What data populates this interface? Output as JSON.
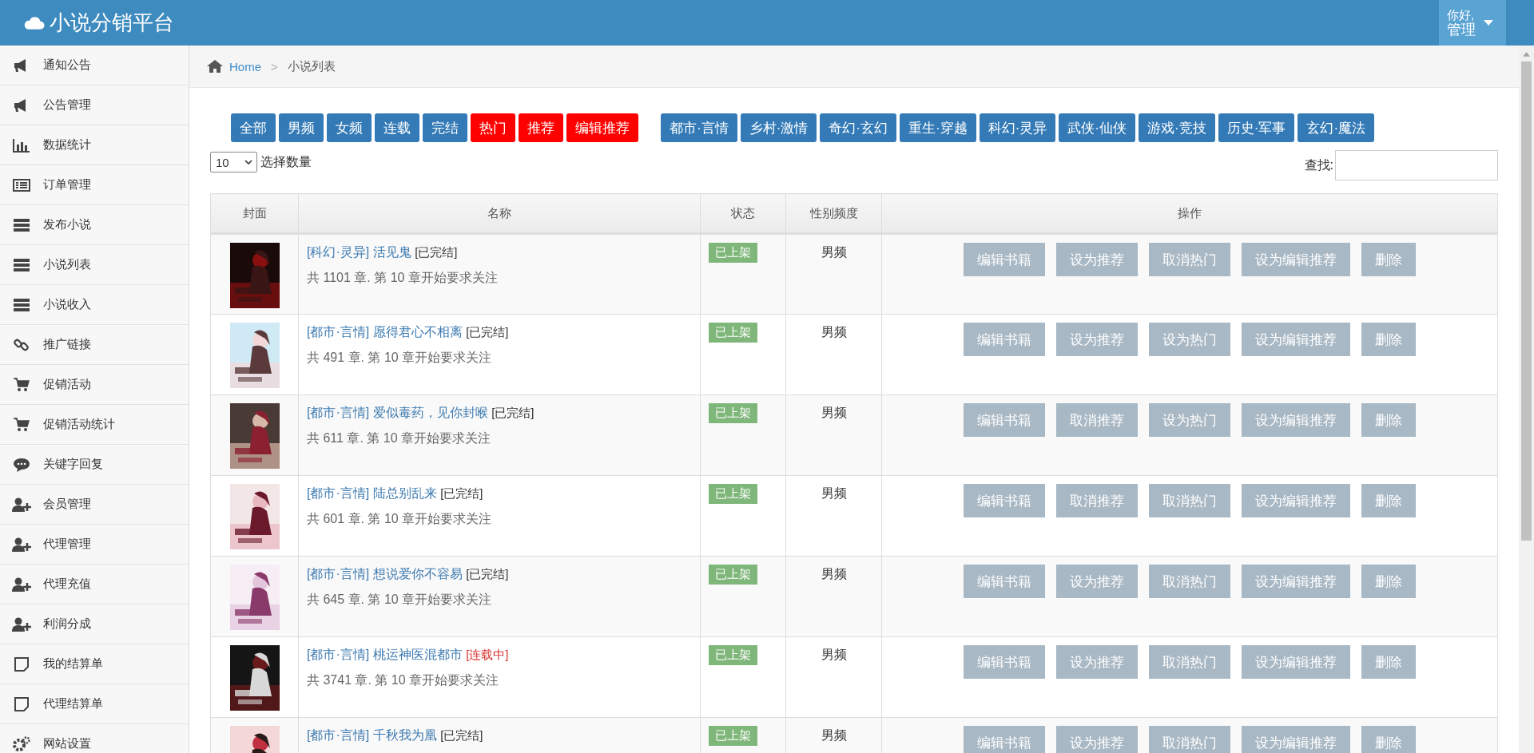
{
  "header": {
    "title": "小说分销平台",
    "user": {
      "greeting": "你好,",
      "name": "管理"
    }
  },
  "sidebar": {
    "items": [
      {
        "label": "通知公告"
      },
      {
        "label": "公告管理"
      },
      {
        "label": "数据统计"
      },
      {
        "label": "订单管理"
      },
      {
        "label": "发布小说"
      },
      {
        "label": "小说列表"
      },
      {
        "label": "小说收入"
      },
      {
        "label": "推广链接"
      },
      {
        "label": "促销活动"
      },
      {
        "label": "促销活动统计"
      },
      {
        "label": "关键字回复"
      },
      {
        "label": "会员管理"
      },
      {
        "label": "代理管理"
      },
      {
        "label": "代理充值"
      },
      {
        "label": "利润分成"
      },
      {
        "label": "我的结算单"
      },
      {
        "label": "代理结算单"
      },
      {
        "label": "网站设置"
      }
    ]
  },
  "breadcrumb": {
    "home": "Home",
    "separator": ">",
    "current": "小说列表"
  },
  "filters": {
    "groups": [
      [
        {
          "label": "全部",
          "kind": "plain"
        },
        {
          "label": "男频",
          "kind": "plain"
        },
        {
          "label": "女频",
          "kind": "plain"
        },
        {
          "label": "连载",
          "kind": "plain"
        },
        {
          "label": "完结",
          "kind": "plain"
        },
        {
          "label": "热门",
          "kind": "hot"
        },
        {
          "label": "推荐",
          "kind": "hot"
        },
        {
          "label": "编辑推荐",
          "kind": "hot"
        }
      ],
      [
        {
          "label": "都市·言情",
          "kind": "plain"
        },
        {
          "label": "乡村·激情",
          "kind": "plain"
        },
        {
          "label": "奇幻·玄幻",
          "kind": "plain"
        },
        {
          "label": "重生·穿越",
          "kind": "plain"
        },
        {
          "label": "科幻·灵异",
          "kind": "plain"
        },
        {
          "label": "武侠·仙侠",
          "kind": "plain"
        },
        {
          "label": "游戏·竞技",
          "kind": "plain"
        },
        {
          "label": "历史·军事",
          "kind": "plain"
        },
        {
          "label": "玄幻·魔法",
          "kind": "plain"
        }
      ]
    ]
  },
  "page_size": {
    "value": "10",
    "label": "选择数量"
  },
  "search": {
    "label": "查找:"
  },
  "table": {
    "columns": [
      "封面",
      "名称",
      "状态",
      "性别频度",
      "操作"
    ],
    "rows": [
      {
        "category": "[科幻·灵异]",
        "title": "活见鬼",
        "serial": {
          "text": "[已完结]",
          "kind": "finished"
        },
        "chapters": "共 1101 章. 第 10 章开始要求关注",
        "status": "已上架",
        "gender": "男频",
        "actions": [
          "编辑书籍",
          "设为推荐",
          "取消热门",
          "设为编辑推荐",
          "删除"
        ]
      },
      {
        "category": "[都市·言情]",
        "title": "愿得君心不相离",
        "serial": {
          "text": "[已完结]",
          "kind": "finished"
        },
        "chapters": "共 491 章. 第 10 章开始要求关注",
        "status": "已上架",
        "gender": "男频",
        "actions": [
          "编辑书籍",
          "设为推荐",
          "设为热门",
          "设为编辑推荐",
          "删除"
        ]
      },
      {
        "category": "[都市·言情]",
        "title": "爱似毒药，见你封喉",
        "serial": {
          "text": "[已完结]",
          "kind": "finished"
        },
        "chapters": "共 611 章. 第 10 章开始要求关注",
        "status": "已上架",
        "gender": "男频",
        "actions": [
          "编辑书籍",
          "取消推荐",
          "设为热门",
          "设为编辑推荐",
          "删除"
        ]
      },
      {
        "category": "[都市·言情]",
        "title": "陆总别乱来",
        "serial": {
          "text": "[已完结]",
          "kind": "finished"
        },
        "chapters": "共 601 章. 第 10 章开始要求关注",
        "status": "已上架",
        "gender": "男频",
        "actions": [
          "编辑书籍",
          "取消推荐",
          "取消热门",
          "设为编辑推荐",
          "删除"
        ]
      },
      {
        "category": "[都市·言情]",
        "title": "想说爱你不容易",
        "serial": {
          "text": "[已完结]",
          "kind": "finished"
        },
        "chapters": "共 645 章. 第 10 章开始要求关注",
        "status": "已上架",
        "gender": "男频",
        "actions": [
          "编辑书籍",
          "设为推荐",
          "取消热门",
          "设为编辑推荐",
          "删除"
        ]
      },
      {
        "category": "[都市·言情]",
        "title": "桃运神医混都市",
        "serial": {
          "text": "[连载中]",
          "kind": "ongoing"
        },
        "chapters": "共 3741 章. 第 10 章开始要求关注",
        "status": "已上架",
        "gender": "男频",
        "actions": [
          "编辑书籍",
          "设为推荐",
          "取消热门",
          "设为编辑推荐",
          "删除"
        ]
      },
      {
        "category": "[都市·言情]",
        "title": "千秋我为凰",
        "serial": {
          "text": "[已完结]",
          "kind": "finished"
        },
        "status": "已上架",
        "gender": "男频",
        "actions": [
          "编辑书籍",
          "设为推荐",
          "取消热门",
          "设为编辑推荐",
          "删除"
        ]
      }
    ]
  }
}
